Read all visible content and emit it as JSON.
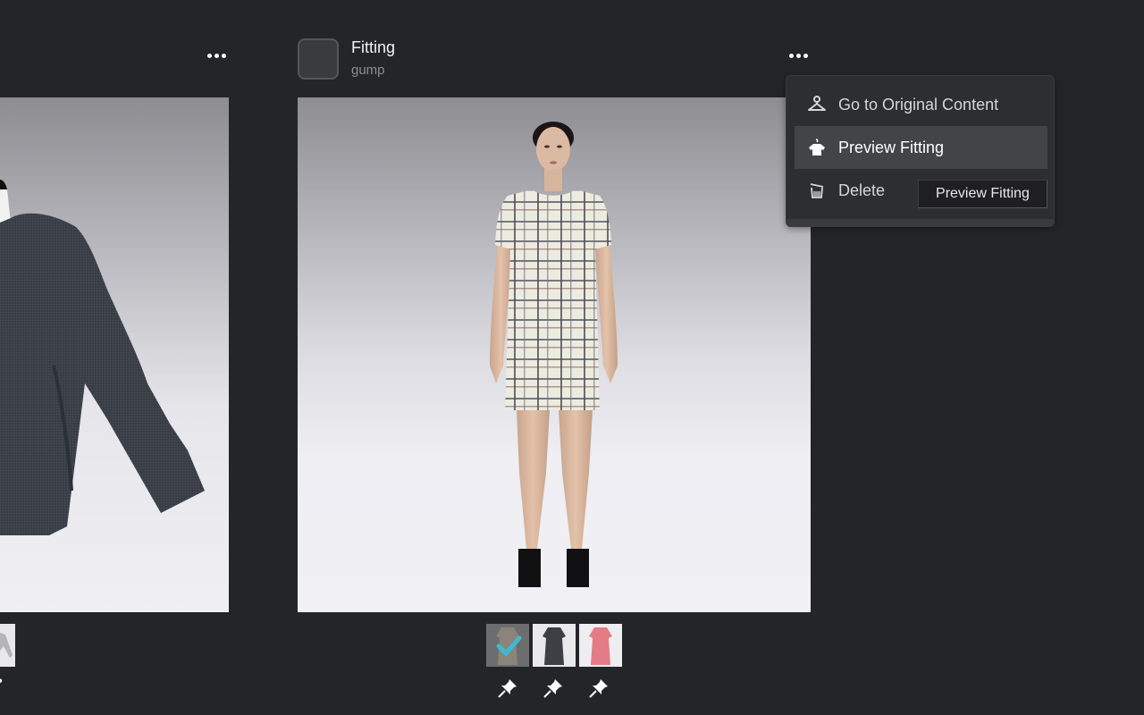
{
  "left_card": {
    "image": "sweater-garment-render",
    "thumbnail": "sweater-thumbnail",
    "more_icon": "more-horizontal-icon"
  },
  "main_card": {
    "title": "Fitting",
    "subtitle": "gump",
    "more_icon": "more-horizontal-icon",
    "image": "avatar-wearing-plaid-dress",
    "variants": [
      {
        "name": "plaid-dress-cream",
        "selected": true
      },
      {
        "name": "plaid-dress-dark",
        "selected": false
      },
      {
        "name": "pink-dress",
        "selected": false
      }
    ],
    "pin_icon": "pin-icon"
  },
  "context_menu": {
    "items": [
      {
        "label": "Go to Original Content",
        "icon": "hanger-icon"
      },
      {
        "label": "Preview Fitting",
        "icon": "shirt-hanger-icon",
        "hovered": true
      },
      {
        "label": "Delete",
        "icon": "trash-icon"
      }
    ]
  },
  "tooltip": {
    "text": "Preview Fitting"
  },
  "colors": {
    "background": "#242528",
    "menu_bg": "#2d2e31",
    "menu_hover": "#434447",
    "check_accent": "#3fb8d4"
  }
}
